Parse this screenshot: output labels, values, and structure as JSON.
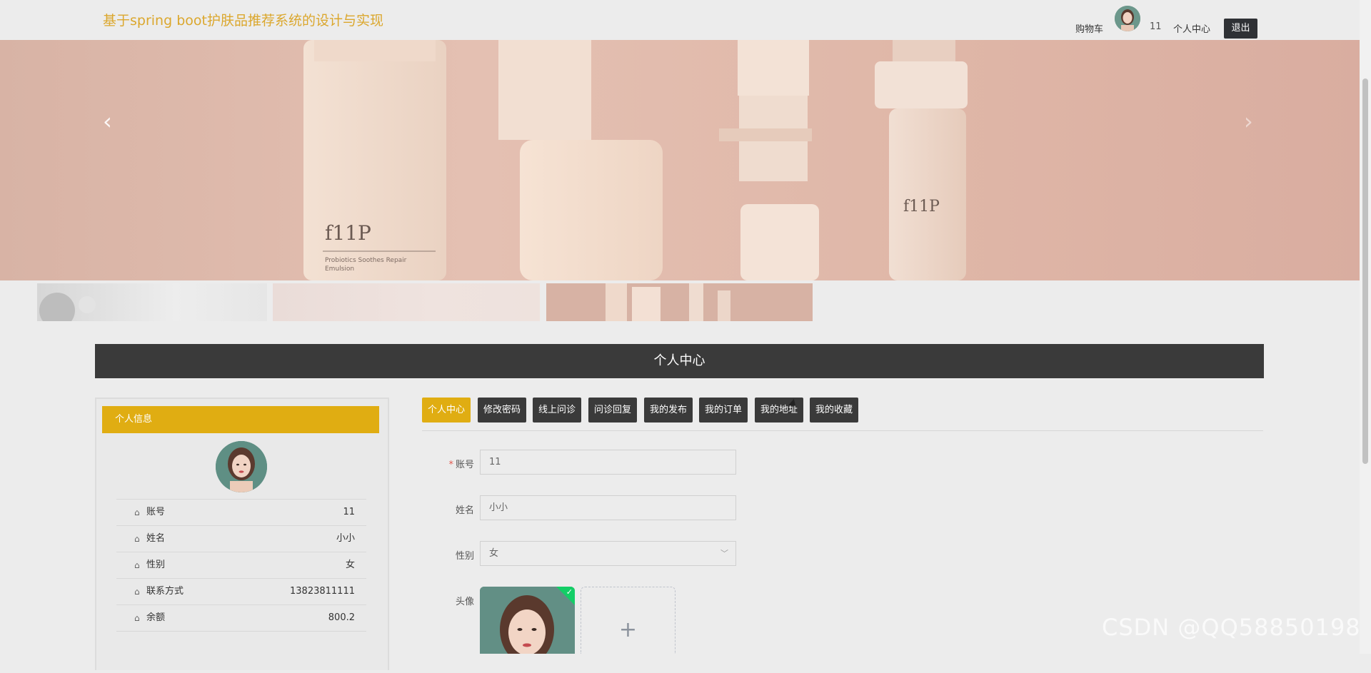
{
  "header": {
    "site_title": "基于spring boot护肤品推荐系统的设计与实现",
    "cart_label": "购物车",
    "username": "11",
    "user_center_label": "个人中心",
    "logout_label": "退出"
  },
  "banner": {
    "prev_icon": "‹",
    "next_icon": "›"
  },
  "section": {
    "title": "个人中心"
  },
  "profile_panel": {
    "heading": "个人信息",
    "items": [
      {
        "label": "账号",
        "value": "11"
      },
      {
        "label": "姓名",
        "value": "小小"
      },
      {
        "label": "性别",
        "value": "女"
      },
      {
        "label": "联系方式",
        "value": "13823811111"
      },
      {
        "label": "余额",
        "value": "800.2"
      }
    ],
    "item_icon": "home-icon"
  },
  "tabs": [
    {
      "label": "个人中心",
      "active": true
    },
    {
      "label": "修改密码",
      "active": false
    },
    {
      "label": "线上问诊",
      "active": false
    },
    {
      "label": "问诊回复",
      "active": false
    },
    {
      "label": "我的发布",
      "active": false
    },
    {
      "label": "我的订单",
      "active": false
    },
    {
      "label": "我的地址",
      "active": false
    },
    {
      "label": "我的收藏",
      "active": false
    }
  ],
  "form": {
    "account_label": "账号",
    "account_value": "11",
    "name_label": "姓名",
    "name_value": "小小",
    "gender_label": "性别",
    "gender_value": "女",
    "avatar_label": "头像",
    "required_mark": "*",
    "add_icon": "+",
    "check_icon": "✓"
  },
  "watermark": "CSDN @QQ58850198",
  "colors": {
    "accent": "#e0ad12",
    "title": "#dba72d",
    "dark": "#3a3a3a"
  }
}
